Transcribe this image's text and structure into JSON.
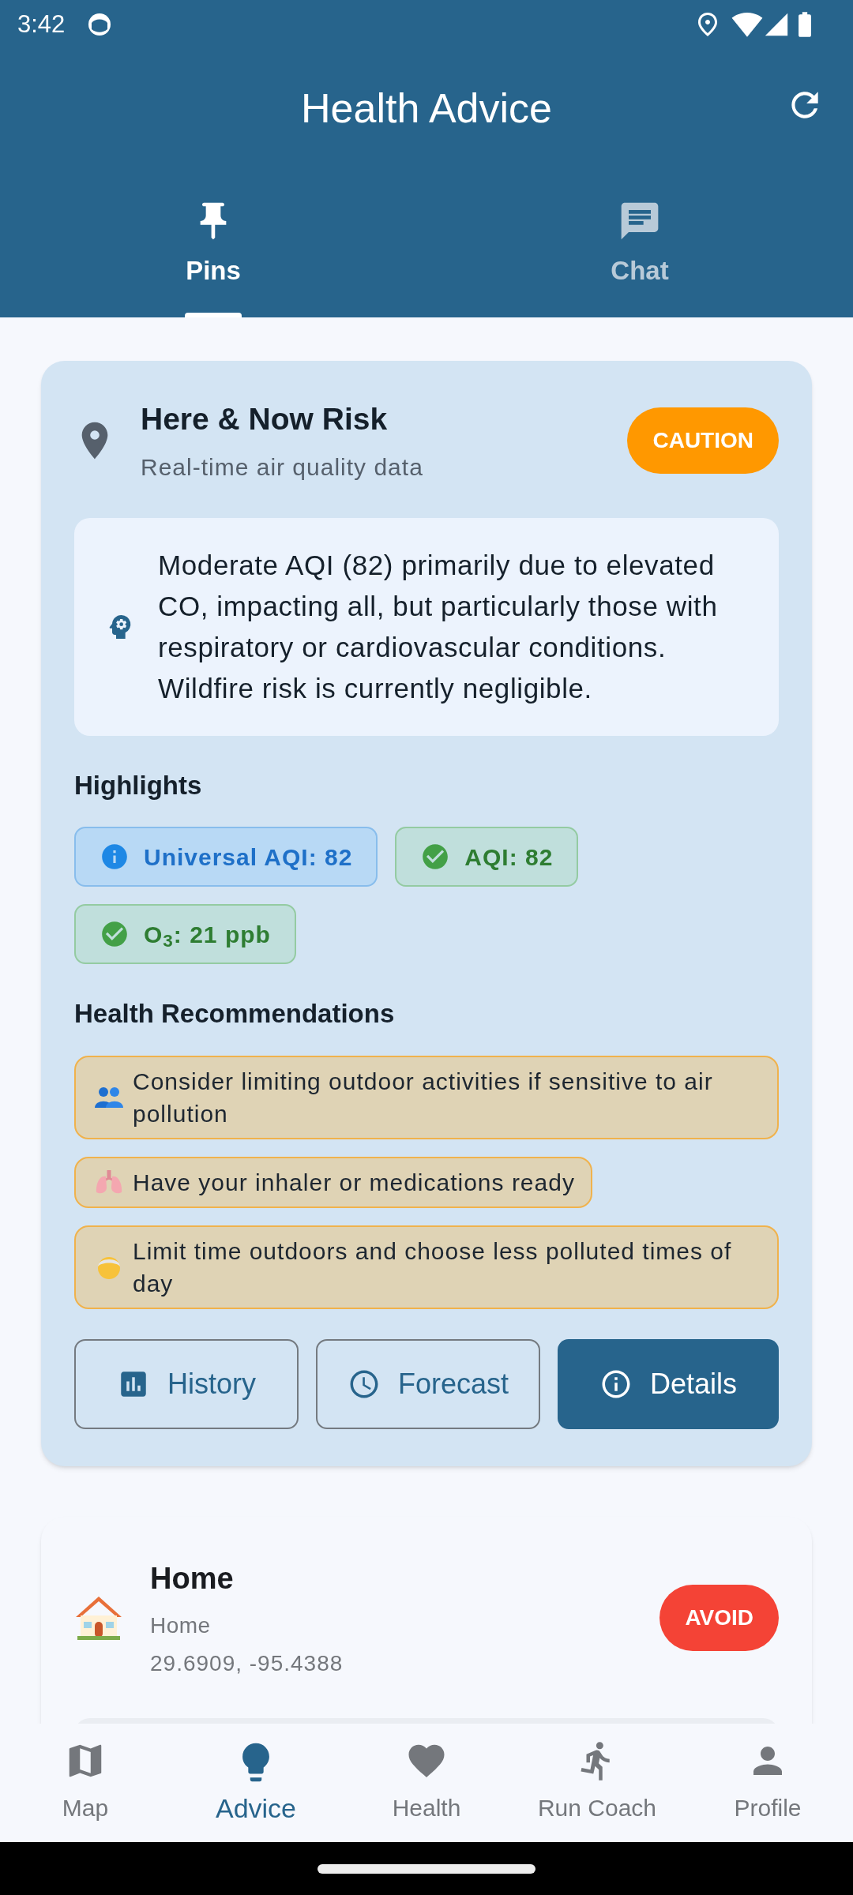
{
  "status_bar": {
    "time": "3:42"
  },
  "app_bar": {
    "title": "Health Advice"
  },
  "tabs": [
    {
      "label": "Pins",
      "selected": true
    },
    {
      "label": "Chat",
      "selected": false
    }
  ],
  "risk_card": {
    "title": "Here & Now Risk",
    "subtitle": "Real-time air quality data",
    "badge": {
      "label": "CAUTION",
      "color": "#ff9800"
    },
    "summary": "Moderate AQI (82) primarily due to elevated CO, impacting all, but particularly those with respiratory or cardiovascular conditions. Wildfire risk is currently negligible.",
    "highlights_title": "Highlights",
    "highlights": [
      {
        "kind": "info",
        "label": "Universal AQI: 82"
      },
      {
        "kind": "good",
        "label": "AQI: 82"
      },
      {
        "kind": "good",
        "label": "O$_{3}$: 21 ppb"
      }
    ],
    "recommendations_title": "Health Recommendations",
    "recommendations": [
      {
        "text": "Consider limiting outdoor activities if sensitive to air pollution"
      },
      {
        "text": "Have your inhaler or medications ready"
      },
      {
        "text": "Limit time outdoors and choose less polluted times of day"
      }
    ],
    "buttons": [
      {
        "kind": "outlined",
        "label": "History"
      },
      {
        "kind": "outlined",
        "label": "Forecast"
      },
      {
        "kind": "filled",
        "label": "Details"
      }
    ]
  },
  "location_card": {
    "title": "Home",
    "subtitle": "Home",
    "coordinates": "29.6909, -95.4388",
    "badge": {
      "label": "AVOID",
      "color": "#f44336"
    }
  },
  "bottom_nav": [
    {
      "label": "Map",
      "selected": false
    },
    {
      "label": "Advice",
      "selected": true
    },
    {
      "label": "Health",
      "selected": false
    },
    {
      "label": "Run Coach",
      "selected": false
    },
    {
      "label": "Profile",
      "selected": false
    }
  ]
}
